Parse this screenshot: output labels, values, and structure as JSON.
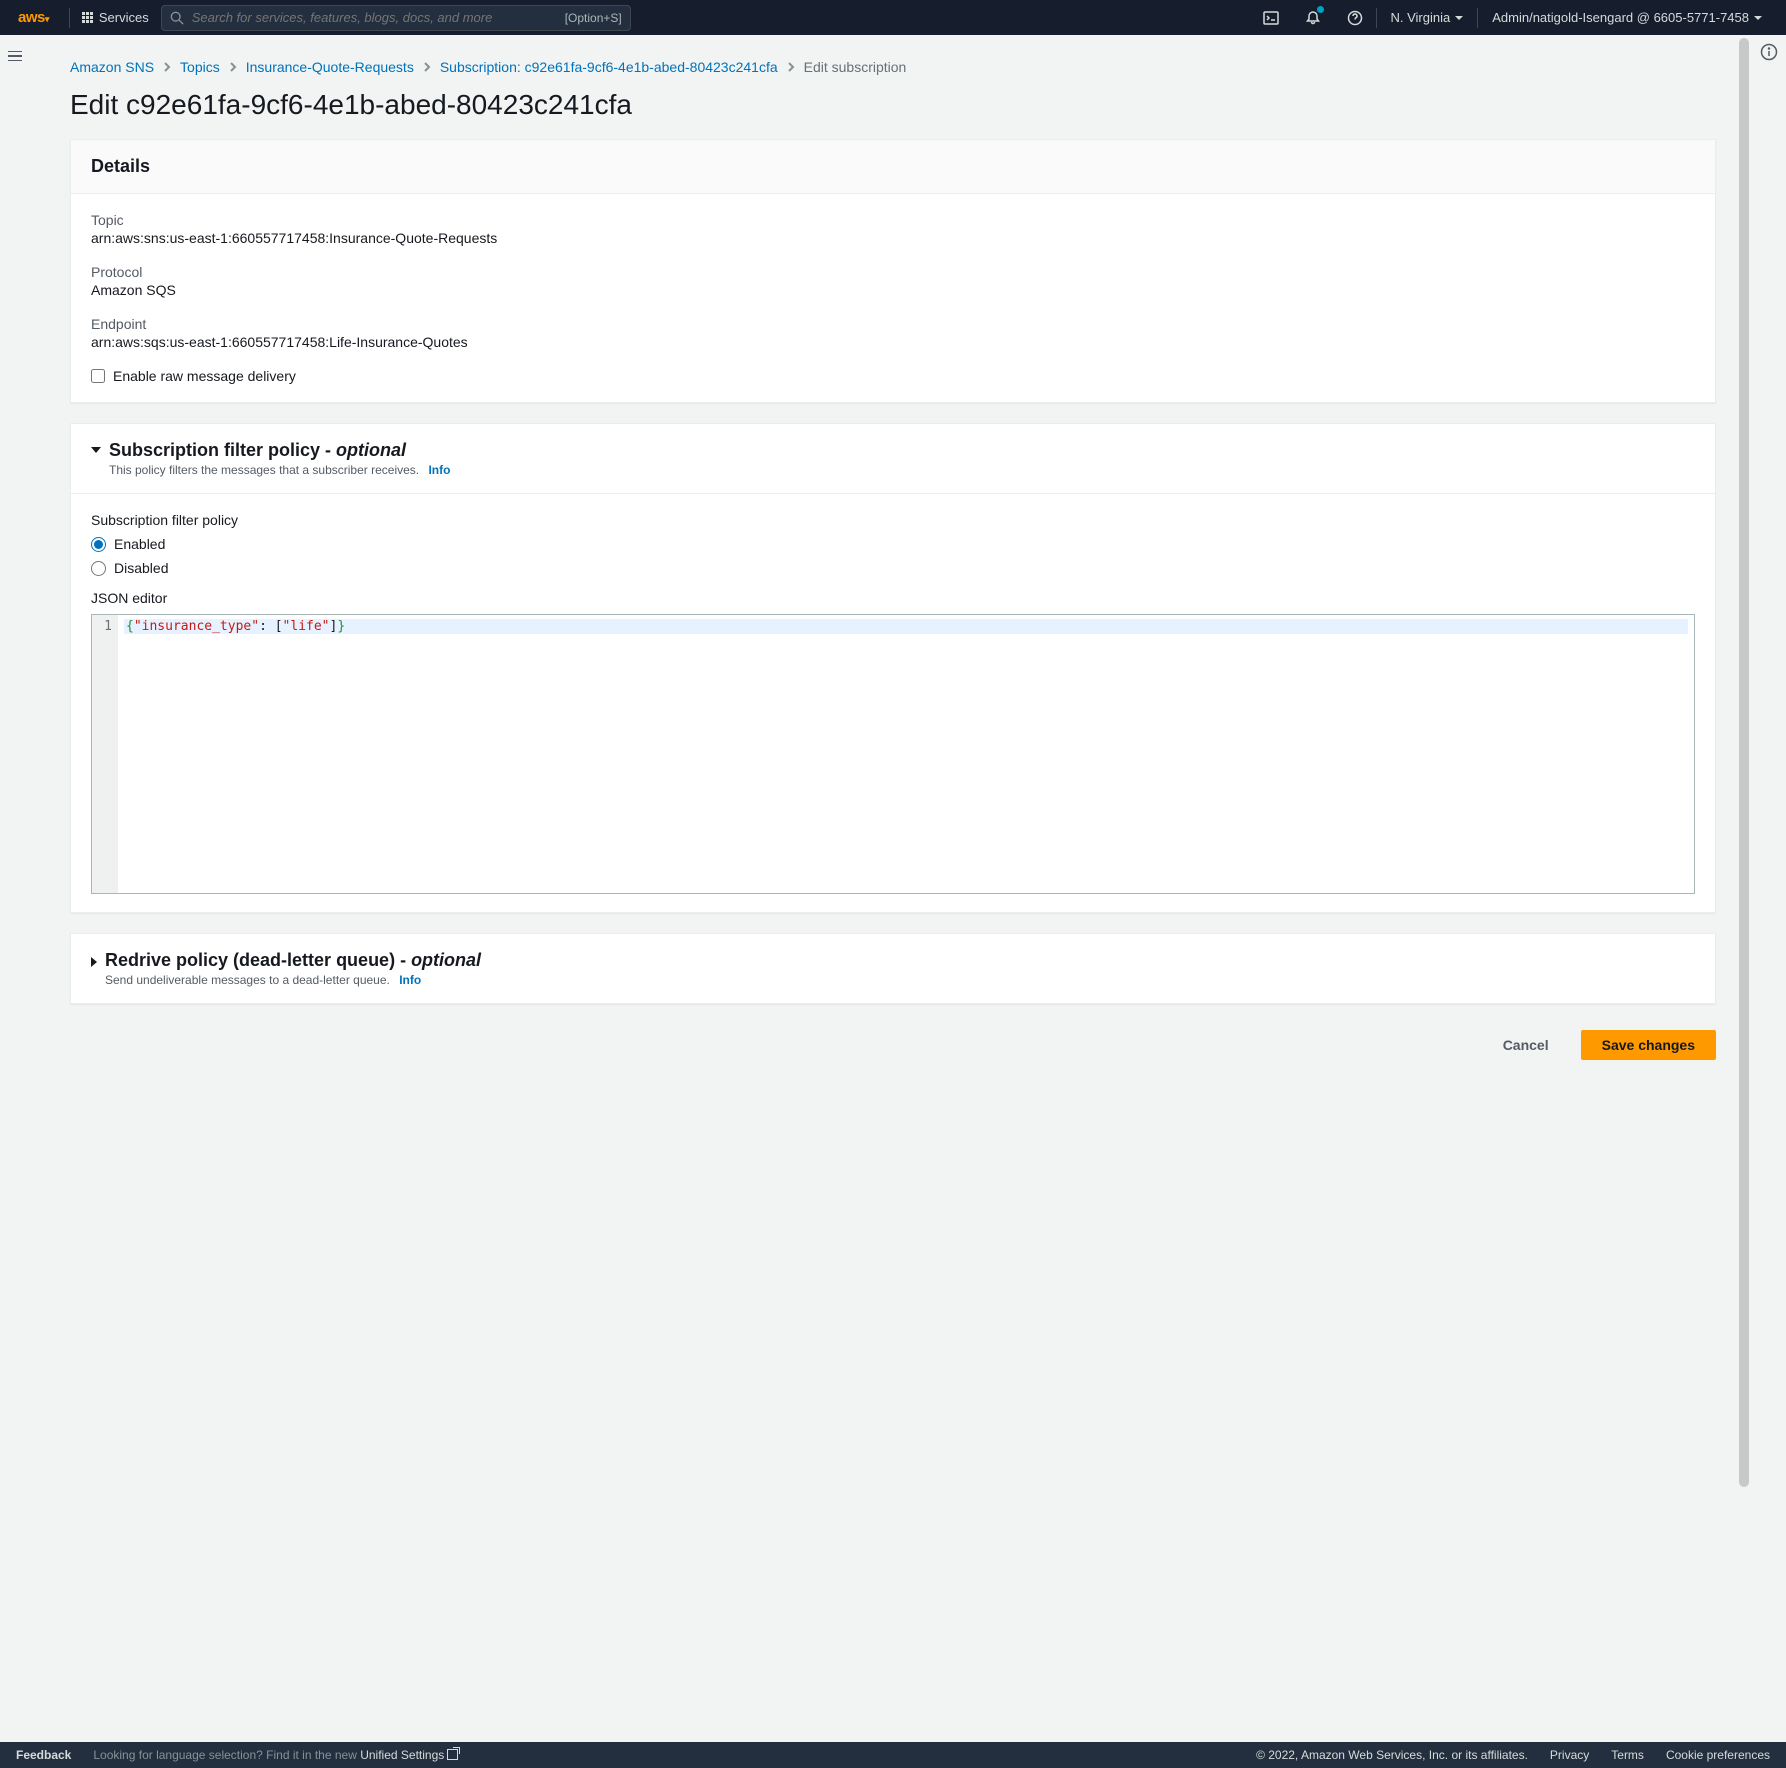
{
  "nav": {
    "logo": "aws",
    "services": "Services",
    "search_placeholder": "Search for services, features, blogs, docs, and more",
    "search_shortcut": "[Option+S]",
    "region": "N. Virginia",
    "account": "Admin/natigold-Isengard @ 6605-5771-7458"
  },
  "breadcrumbs": {
    "items": [
      "Amazon SNS",
      "Topics",
      "Insurance-Quote-Requests",
      "Subscription: c92e61fa-9cf6-4e1b-abed-80423c241cfa"
    ],
    "current": "Edit subscription"
  },
  "page_title": "Edit c92e61fa-9cf6-4e1b-abed-80423c241cfa",
  "details": {
    "heading": "Details",
    "topic_label": "Topic",
    "topic_value": "arn:aws:sns:us-east-1:660557717458:Insurance-Quote-Requests",
    "protocol_label": "Protocol",
    "protocol_value": "Amazon SQS",
    "endpoint_label": "Endpoint",
    "endpoint_value": "arn:aws:sqs:us-east-1:660557717458:Life-Insurance-Quotes",
    "raw_delivery_label": "Enable raw message delivery"
  },
  "filter_policy": {
    "title_main": "Subscription filter policy - ",
    "title_opt": "optional",
    "sub": "This policy filters the messages that a subscriber receives.",
    "info": "Info",
    "label": "Subscription filter policy",
    "enabled": "Enabled",
    "disabled": "Disabled",
    "json_editor": "JSON editor",
    "line_num": "1",
    "code": {
      "open_brace": "{",
      "key": "\"insurance_type\"",
      "colon": ": ",
      "open_bracket": "[",
      "val": "\"life\"",
      "close_bracket": "]",
      "close_brace": "}"
    }
  },
  "redrive": {
    "title_main": "Redrive policy (dead-letter queue) - ",
    "title_opt": "optional",
    "sub": "Send undeliverable messages to a dead-letter queue.",
    "info": "Info"
  },
  "buttons": {
    "cancel": "Cancel",
    "save": "Save changes"
  },
  "footer": {
    "feedback": "Feedback",
    "lang_hint": "Looking for language selection? Find it in the new ",
    "unified": "Unified Settings",
    "copyright": "© 2022, Amazon Web Services, Inc. or its affiliates.",
    "privacy": "Privacy",
    "terms": "Terms",
    "cookies": "Cookie preferences"
  }
}
